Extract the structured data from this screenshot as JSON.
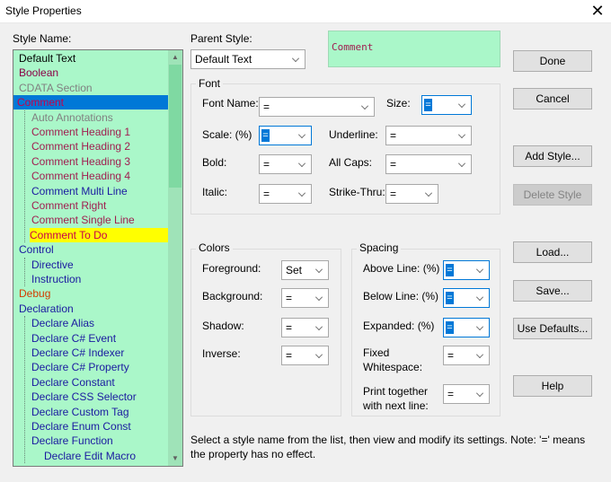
{
  "window": {
    "title": "Style Properties"
  },
  "labels": {
    "style_name": "Style Name:",
    "parent_style": "Parent Style:",
    "font": "Font",
    "font_name": "Font Name:",
    "size": "Size:",
    "scale": "Scale: (%)",
    "underline": "Underline:",
    "bold": "Bold:",
    "all_caps": "All Caps:",
    "italic": "Italic:",
    "strike_thru": "Strike-Thru:",
    "colors": "Colors",
    "foreground": "Foreground:",
    "background": "Background:",
    "shadow": "Shadow:",
    "inverse": "Inverse:",
    "spacing": "Spacing",
    "above_line": "Above Line: (%)",
    "below_line": "Below Line: (%)",
    "expanded": "Expanded: (%)",
    "fixed_1": "Fixed",
    "fixed_2": "Whitespace:",
    "print_1": "Print together",
    "print_2": "with next line:"
  },
  "values": {
    "parent_style": "Default Text",
    "preview_text": "Comment",
    "font_name": "=",
    "size": "=",
    "scale": "=",
    "underline": "=",
    "bold": "=",
    "all_caps": "=",
    "italic": "=",
    "strike_thru": "=",
    "foreground": "Set",
    "background": "=",
    "shadow": "=",
    "inverse": "=",
    "above_line": "=",
    "below_line": "=",
    "expanded": "=",
    "fixed_whitespace": "=",
    "print_together": "="
  },
  "buttons": {
    "done": "Done",
    "cancel": "Cancel",
    "add_style": "Add Style...",
    "delete_style": "Delete Style",
    "load": "Load...",
    "save": "Save...",
    "use_defaults": "Use Defaults...",
    "help": "Help"
  },
  "note": "Select a style name from the list, then view and modify its settings. Note: '=' means the property has no effect.",
  "colors": {
    "list_bg": "#aaf7c9",
    "selected_bg": "#0078d7",
    "highlight_bg": "#ffff00"
  },
  "styles": [
    {
      "label": "Default Text",
      "level": 0,
      "color": "#000000"
    },
    {
      "label": "Boolean",
      "level": 0,
      "color": "#8b0046"
    },
    {
      "label": "CDATA Section",
      "level": 0,
      "color": "#808080"
    },
    {
      "label": "Comment",
      "level": 0,
      "color": "#c8004a",
      "state": "selected"
    },
    {
      "label": "Auto Annotations",
      "level": 1,
      "color": "#808080"
    },
    {
      "label": "Comment Heading 1",
      "level": 1,
      "color": "#a01e50"
    },
    {
      "label": "Comment Heading 2",
      "level": 1,
      "color": "#a01e50"
    },
    {
      "label": "Comment Heading 3",
      "level": 1,
      "color": "#a01e50"
    },
    {
      "label": "Comment Heading 4",
      "level": 1,
      "color": "#a01e50"
    },
    {
      "label": "Comment Multi Line",
      "level": 1,
      "color": "#1a1aa0"
    },
    {
      "label": "Comment Right",
      "level": 1,
      "color": "#a01e50"
    },
    {
      "label": "Comment Single Line",
      "level": 1,
      "color": "#a01e50"
    },
    {
      "label": "Comment To Do",
      "level": 1,
      "color": "#c8004a",
      "state": "highlight"
    },
    {
      "label": "Control",
      "level": 0,
      "color": "#1a1aa0"
    },
    {
      "label": "Directive",
      "level": 1,
      "color": "#1a1aa0"
    },
    {
      "label": "Instruction",
      "level": 1,
      "color": "#1a1aa0"
    },
    {
      "label": "Debug",
      "level": 0,
      "color": "#d23c00"
    },
    {
      "label": "Declaration",
      "level": 0,
      "color": "#1a1aa0"
    },
    {
      "label": "Declare Alias",
      "level": 1,
      "color": "#1a1aa0"
    },
    {
      "label": "Declare C# Event",
      "level": 1,
      "color": "#1a1aa0"
    },
    {
      "label": "Declare C# Indexer",
      "level": 1,
      "color": "#1a1aa0"
    },
    {
      "label": "Declare C# Property",
      "level": 1,
      "color": "#1a1aa0"
    },
    {
      "label": "Declare Constant",
      "level": 1,
      "color": "#1a1aa0"
    },
    {
      "label": "Declare CSS Selector",
      "level": 1,
      "color": "#1a1aa0"
    },
    {
      "label": "Declare Custom Tag",
      "level": 1,
      "color": "#1a1aa0"
    },
    {
      "label": "Declare Enum Const",
      "level": 1,
      "color": "#1a1aa0"
    },
    {
      "label": "Declare Function",
      "level": 1,
      "color": "#1a1aa0"
    },
    {
      "label": "Declare Edit Macro",
      "level": 2,
      "color": "#1a1aa0"
    }
  ]
}
